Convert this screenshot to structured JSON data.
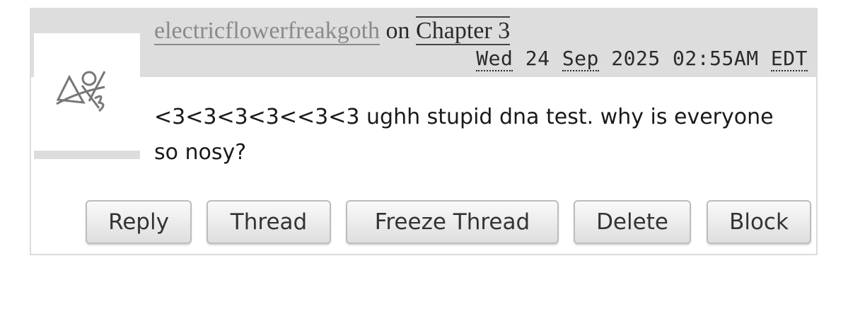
{
  "comment": {
    "author": "electricflowerfreakgoth",
    "connector": "on",
    "work_title": "Chapter 3",
    "date": {
      "weekday": "Wed",
      "day": "24",
      "month": "Sep",
      "year": "2025",
      "time": "02:55AM",
      "timezone": "EDT"
    },
    "text": "<3<3<3<3<<3<3 ughh stupid dna test. why is everyone so nosy?",
    "avatar_icon": "default-avatar-icon"
  },
  "actions": {
    "reply": "Reply",
    "thread": "Thread",
    "freeze_thread": "Freeze Thread",
    "delete": "Delete",
    "block": "Block"
  }
}
